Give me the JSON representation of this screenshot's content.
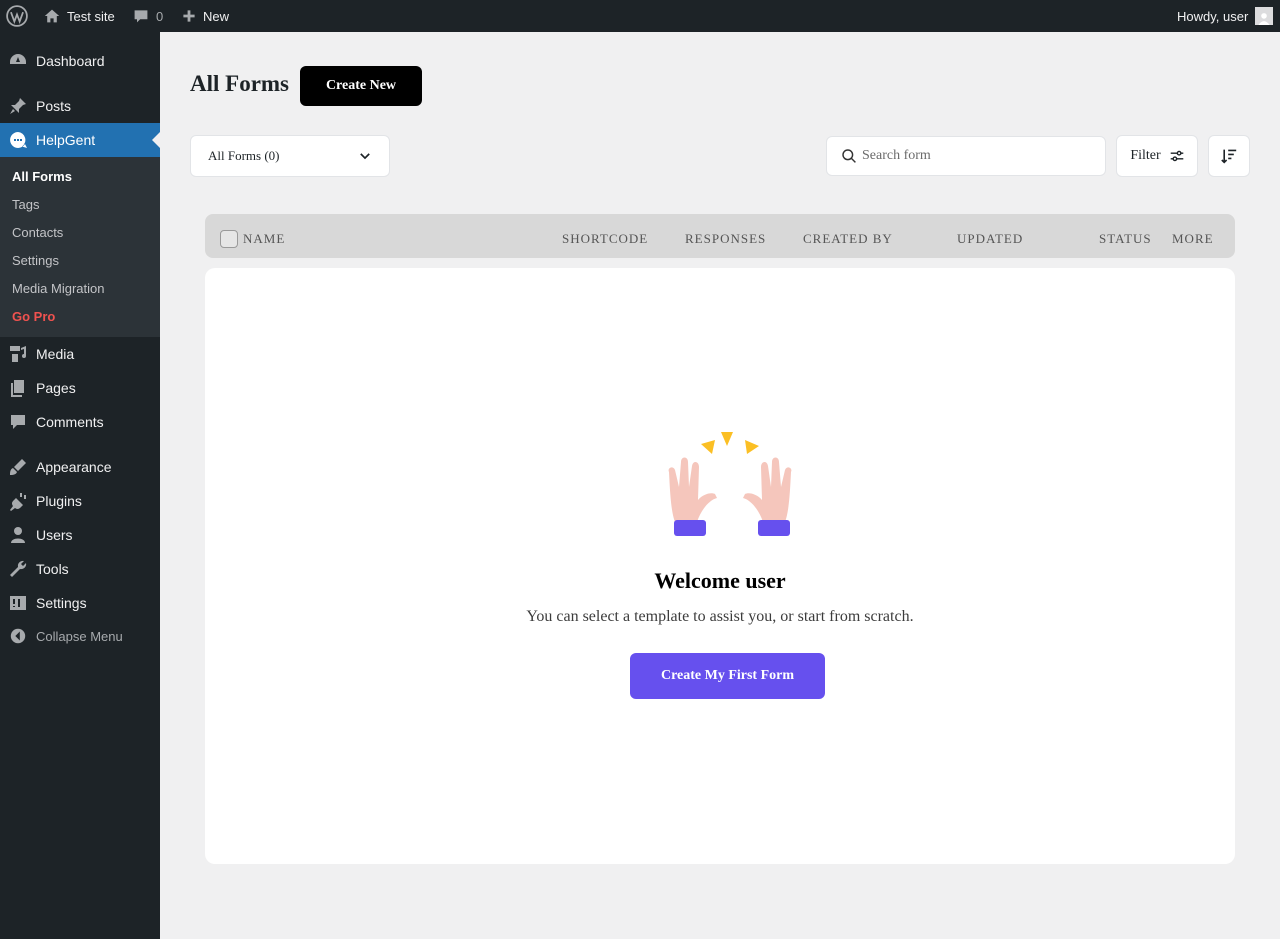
{
  "adminbar": {
    "site_name": "Test site",
    "comments_count": "0",
    "new_label": "New",
    "howdy": "Howdy, user"
  },
  "sidebar": {
    "items": [
      {
        "label": "Dashboard",
        "icon": "dashboard-icon"
      },
      {
        "label": "Posts",
        "icon": "pin-icon"
      },
      {
        "label": "HelpGent",
        "icon": "helpgent-chat-icon"
      },
      {
        "label": "Media",
        "icon": "media-icon"
      },
      {
        "label": "Pages",
        "icon": "pages-icon"
      },
      {
        "label": "Comments",
        "icon": "comment-icon"
      },
      {
        "label": "Appearance",
        "icon": "brush-icon"
      },
      {
        "label": "Plugins",
        "icon": "plugin-icon"
      },
      {
        "label": "Users",
        "icon": "user-icon"
      },
      {
        "label": "Tools",
        "icon": "wrench-icon"
      },
      {
        "label": "Settings",
        "icon": "settings-icon"
      }
    ],
    "submenu": [
      "All Forms",
      "Tags",
      "Contacts",
      "Settings",
      "Media Migration",
      "Go Pro"
    ],
    "collapse_label": "Collapse Menu"
  },
  "main": {
    "title": "All Forms",
    "create_new_label": "Create New",
    "filter_select": "All Forms (0)",
    "search_placeholder": "Search form",
    "filter_label": "Filter",
    "columns": [
      "Name",
      "Shortcode",
      "Responses",
      "Created By",
      "Updated",
      "Status",
      "More"
    ],
    "empty": {
      "title": "Welcome user",
      "subtitle": "You can select a template to assist you, or start from scratch.",
      "button_label": "Create My First Form"
    }
  },
  "colors": {
    "admin_bg": "#1d2327",
    "active_menu": "#2271b1",
    "go_pro": "#f0524f",
    "primary_button": "#6650ee"
  }
}
